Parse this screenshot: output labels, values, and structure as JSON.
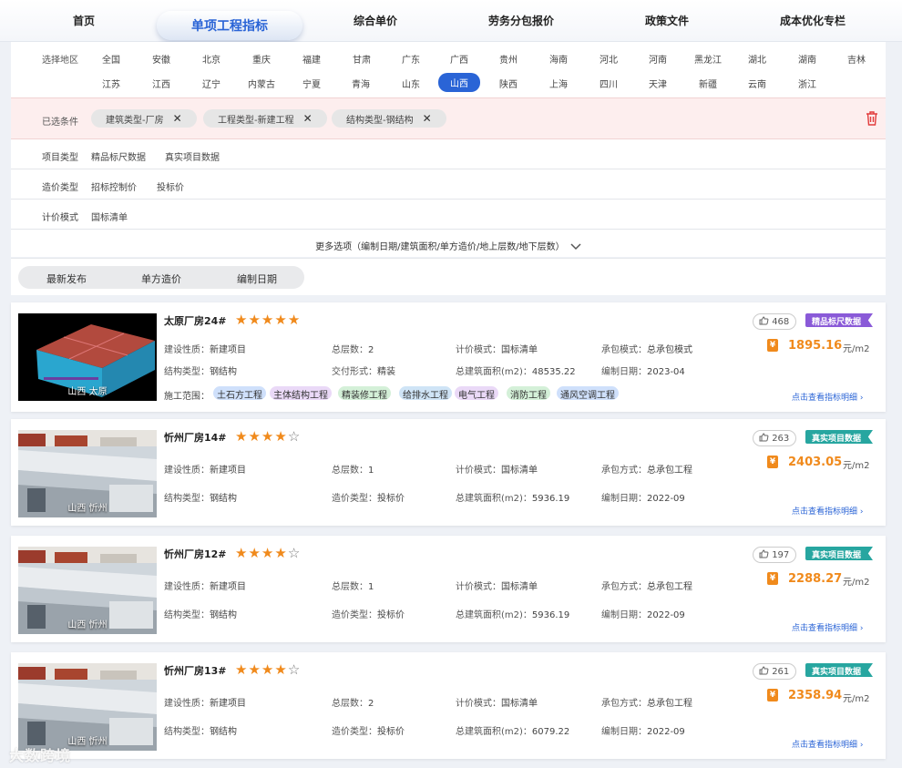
{
  "nav": {
    "items": [
      "首页",
      "单项工程指标",
      "综合单价",
      "劳务分包报价",
      "政策文件",
      "成本优化专栏"
    ],
    "active_index": 1
  },
  "region": {
    "label": "选择地区",
    "row1": [
      "全国",
      "安徽",
      "北京",
      "重庆",
      "福建",
      "甘肃",
      "广东",
      "广西",
      "贵州",
      "海南",
      "河北",
      "河南",
      "黑龙江",
      "湖北",
      "湖南",
      "吉林"
    ],
    "row2": [
      "江苏",
      "江西",
      "辽宁",
      "内蒙古",
      "宁夏",
      "青海",
      "山东",
      "山西",
      "陕西",
      "上海",
      "四川",
      "天津",
      "新疆",
      "云南",
      "浙江"
    ],
    "selected": "山西"
  },
  "selected_filters": {
    "label": "已选条件",
    "chips": [
      "建筑类型-厂房",
      "工程类型-新建工程",
      "结构类型-钢结构"
    ]
  },
  "filters": [
    {
      "label": "项目类型",
      "options": [
        "精品标尺数据",
        "真实项目数据"
      ]
    },
    {
      "label": "造价类型",
      "options": [
        "招标控制价",
        "投标价"
      ]
    },
    {
      "label": "计价模式",
      "options": [
        "国标清单"
      ]
    }
  ],
  "more_options": "更多选项（编制日期/建筑面积/单方造价/地上层数/地下层数）",
  "sort": [
    "最新发布",
    "单方造价",
    "编制日期"
  ],
  "cards": [
    {
      "title": "太原厂房24#",
      "stars": 5,
      "location": "山西 太原",
      "likes": "468",
      "badge": "精品标尺数据",
      "badge_color": "#8a5ad8",
      "row1": [
        [
          "建设性质：",
          "新建项目"
        ],
        [
          "总层数：",
          "2"
        ],
        [
          "计价模式：",
          "国标清单"
        ],
        [
          "承包模式：",
          "总承包模式"
        ]
      ],
      "row2": [
        [
          "结构类型：",
          "钢结构"
        ],
        [
          "交付形式：",
          "精装"
        ],
        [
          "总建筑面积(m2)：",
          "48535.22"
        ],
        [
          "编制日期：",
          "2023-04"
        ]
      ],
      "scope_label": "施工范围：",
      "scope": [
        "土石方工程",
        "主体结构工程",
        "精装修工程",
        "给排水工程",
        "电气工程",
        "消防工程",
        "通风空调工程"
      ],
      "price": "1895.16",
      "unit": "元/m2",
      "detail": "点击查看指标明细"
    },
    {
      "title": "忻州厂房14#",
      "stars": 4,
      "location": "山西 忻州",
      "likes": "263",
      "badge": "真实项目数据",
      "badge_color": "#27a6a0",
      "row1": [
        [
          "建设性质：",
          "新建项目"
        ],
        [
          "总层数：",
          "1"
        ],
        [
          "计价模式：",
          "国标清单"
        ],
        [
          "承包方式：",
          "总承包工程"
        ]
      ],
      "row2": [
        [
          "结构类型：",
          "钢结构"
        ],
        [
          "造价类型：",
          "投标价"
        ],
        [
          "总建筑面积(m2)：",
          "5936.19"
        ],
        [
          "编制日期：",
          "2022-09"
        ]
      ],
      "price": "2403.05",
      "unit": "元/m2",
      "detail": "点击查看指标明细"
    },
    {
      "title": "忻州厂房12#",
      "stars": 4,
      "location": "山西 忻州",
      "likes": "197",
      "badge": "真实项目数据",
      "badge_color": "#27a6a0",
      "row1": [
        [
          "建设性质：",
          "新建项目"
        ],
        [
          "总层数：",
          "1"
        ],
        [
          "计价模式：",
          "国标清单"
        ],
        [
          "承包方式：",
          "总承包工程"
        ]
      ],
      "row2": [
        [
          "结构类型：",
          "钢结构"
        ],
        [
          "造价类型：",
          "投标价"
        ],
        [
          "总建筑面积(m2)：",
          "5936.19"
        ],
        [
          "编制日期：",
          "2022-09"
        ]
      ],
      "price": "2288.27",
      "unit": "元/m2",
      "detail": "点击查看指标明细"
    },
    {
      "title": "忻州厂房13#",
      "stars": 4,
      "location": "山西 忻州",
      "likes": "261",
      "badge": "真实项目数据",
      "badge_color": "#27a6a0",
      "row1": [
        [
          "建设性质：",
          "新建项目"
        ],
        [
          "总层数：",
          "2"
        ],
        [
          "计价模式：",
          "国标清单"
        ],
        [
          "承包方式：",
          "总承包工程"
        ]
      ],
      "row2": [
        [
          "结构类型：",
          "钢结构"
        ],
        [
          "造价类型：",
          "投标价"
        ],
        [
          "总建筑面积(m2)：",
          "6079.22"
        ],
        [
          "编制日期：",
          "2022-09"
        ]
      ],
      "price": "2358.94",
      "unit": "元/m2",
      "detail": "点击查看指标明细"
    }
  ],
  "tag_colors": [
    "#cfe0fb",
    "#ead9f7",
    "#d4f0d8",
    "#cfe4f6",
    "#ead9f7",
    "#d4f0d8",
    "#cfe0fb"
  ],
  "watermark": "大数跨境"
}
